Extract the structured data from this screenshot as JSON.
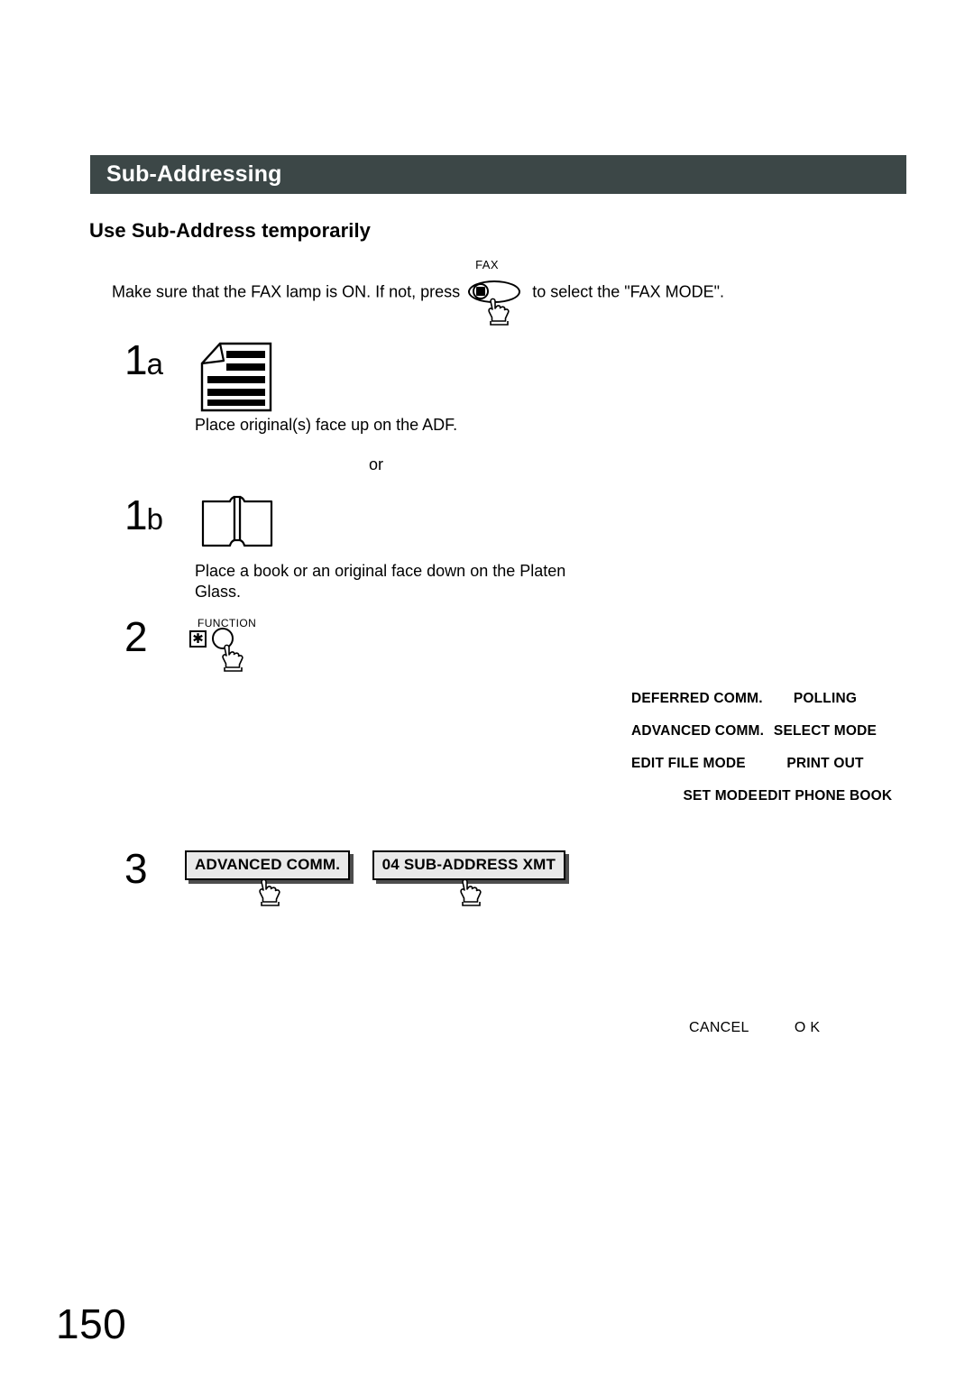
{
  "header": {
    "title": "Sub-Addressing",
    "bar_color": "#3c4747",
    "text_color": "#ffffff"
  },
  "subtitle": "Use Sub-Address temporarily",
  "intro": {
    "part1": "Make sure that the FAX lamp is ON.  If not, press",
    "part2": "to select the \"FAX MODE\".",
    "key_label": "FAX",
    "key_icon": "fax-key-icon",
    "hand_icon": "pointing-hand-icon"
  },
  "steps": [
    {
      "number": "1",
      "sub": "a",
      "icon": "adf-document-icon",
      "caption": "Place original(s) face up on the ADF."
    },
    {
      "number": "1",
      "sub": "b",
      "icon": "open-book-icon",
      "caption": "Place a book or an original face down on the Platen Glass."
    },
    {
      "number": "2",
      "sub": "",
      "icon": "function-key-icon",
      "caption": ""
    },
    {
      "number": "3",
      "sub": "",
      "icon": "",
      "caption": ""
    }
  ],
  "or_text": "or",
  "function_key": {
    "label": "FUNCTION",
    "asterisk_glyph": "✱",
    "hand_icon": "pointing-hand-icon"
  },
  "menu": {
    "rows": [
      {
        "left": "DEFERRED COMM.",
        "right": "POLLING",
        "left_align": "ta-l",
        "right_align": "ta-c"
      },
      {
        "left": "ADVANCED COMM.",
        "right": "SELECT MODE",
        "left_align": "ta-l",
        "right_align": "ta-c"
      },
      {
        "left": "EDIT FILE MODE",
        "right": "PRINT OUT",
        "left_align": "ta-l",
        "right_align": "ta-c"
      },
      {
        "left": "SET MODE",
        "right": "EDIT PHONE BOOK",
        "left_align": "ta-r",
        "right_align": "ta-c"
      }
    ]
  },
  "step3_buttons": [
    {
      "label": "ADVANCED COMM.",
      "hand_icon": "pointing-hand-icon"
    },
    {
      "label": "04 SUB-ADDRESS XMT",
      "hand_icon": "pointing-hand-icon"
    }
  ],
  "footer_actions": {
    "cancel": "CANCEL",
    "ok": "O K"
  },
  "page_number": "150"
}
